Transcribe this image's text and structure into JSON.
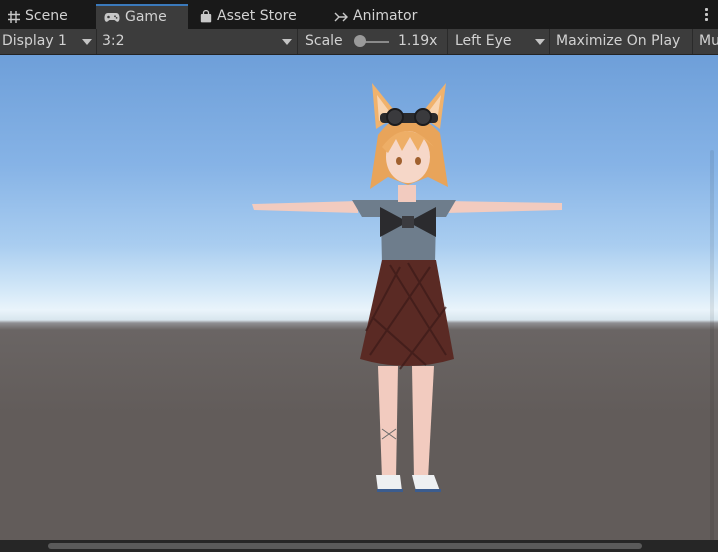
{
  "tabs": [
    {
      "label": "Scene",
      "icon": "grid-icon",
      "active": false
    },
    {
      "label": "Game",
      "icon": "gamepad-icon",
      "active": true
    },
    {
      "label": "Asset Store",
      "icon": "shopping-bag-icon",
      "active": false
    },
    {
      "label": "Animator",
      "icon": "animator-icon",
      "active": false
    }
  ],
  "toolbar": {
    "display": "Display 1",
    "aspect": "3:2",
    "scale_label": "Scale",
    "scale_value": "1.19x",
    "scale_level": 0.05,
    "eye": "Left Eye",
    "maximize": "Maximize On Play",
    "mute": "Mu"
  },
  "colors": {
    "accent": "#3a79bb",
    "panel": "#3c3c3c",
    "background": "#191919",
    "sky_top": "#6e9fd9",
    "ground": "#625c5a"
  }
}
